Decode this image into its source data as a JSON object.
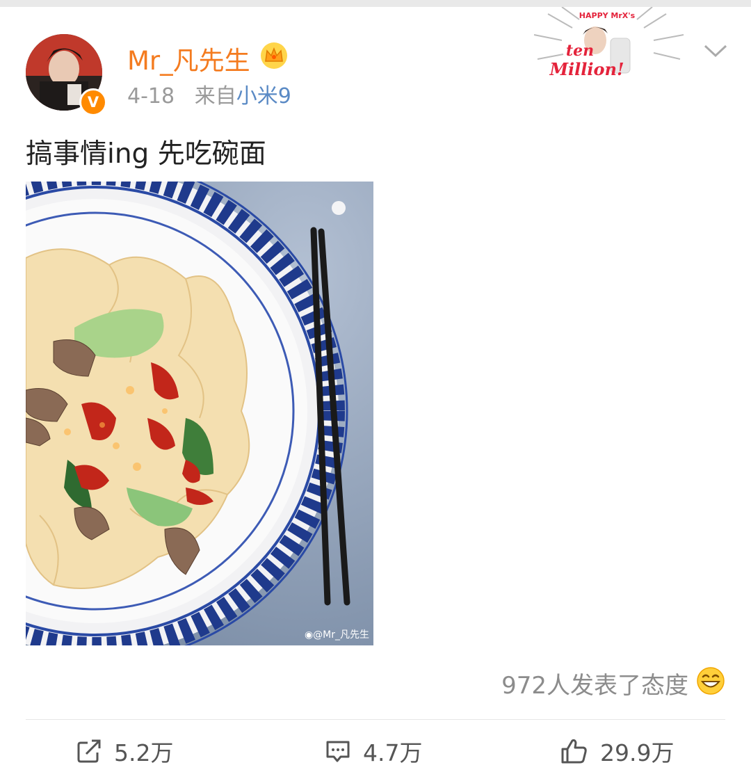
{
  "post": {
    "author": "Mr_凡先生",
    "time": "4-18",
    "source_prefix": "来自",
    "source_device": "小米9",
    "text": "搞事情ing 先吃碗面",
    "image_watermark": "@Mr_凡先生",
    "badge_text": "V"
  },
  "stamp": {
    "top_text": "HAPPY MrX's",
    "line1": "ten",
    "line2": "Million!"
  },
  "reactions": {
    "attitude_text": "972人发表了态度"
  },
  "actions": {
    "share_count": "5.2万",
    "comment_count": "4.7万",
    "like_count": "29.9万"
  },
  "colors": {
    "username": "#f47b1f",
    "source_link": "#5a8ac5",
    "verified_badge": "#ff8a00",
    "stamp_red": "#e4233b"
  },
  "icons": [
    "crown-icon",
    "verified-v-icon",
    "chevron-down-icon",
    "grin-emoji-icon",
    "share-icon",
    "comment-icon",
    "like-icon"
  ]
}
